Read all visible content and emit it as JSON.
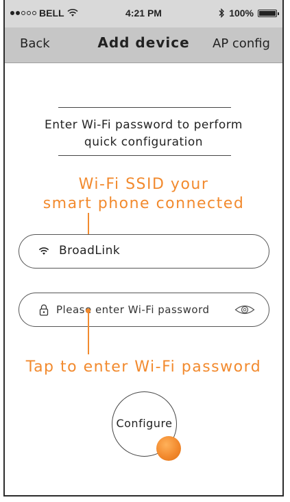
{
  "status_bar": {
    "carrier": "BELL",
    "signal_icon": "signal-dots-icon",
    "wifi_icon": "wifi-icon",
    "time": "4:21 PM",
    "bluetooth_icon": "bluetooth-icon",
    "battery_percent": "100%",
    "battery_level": 1.0
  },
  "nav": {
    "back_label": "Back",
    "title": "Add device",
    "right_label": "AP config"
  },
  "instruction": {
    "line1": "Enter Wi-Fi password to perform",
    "line2": "quick configuration"
  },
  "annotations": {
    "ssid_line1": "Wi-Fi SSID your",
    "ssid_line2": "smart phone connected",
    "password": "Tap to enter Wi-Fi password"
  },
  "ssid_field": {
    "icon": "wifi-icon",
    "value": "BroadLink"
  },
  "password_field": {
    "icon": "lock-icon",
    "placeholder": "Please enter Wi-Fi password",
    "toggle_icon": "eye-icon"
  },
  "configure_button": {
    "label": "Configure"
  },
  "colors": {
    "accent": "#f28a2e",
    "status_bar_bg": "#d9d9d9",
    "nav_bg": "#c6c6c6"
  }
}
